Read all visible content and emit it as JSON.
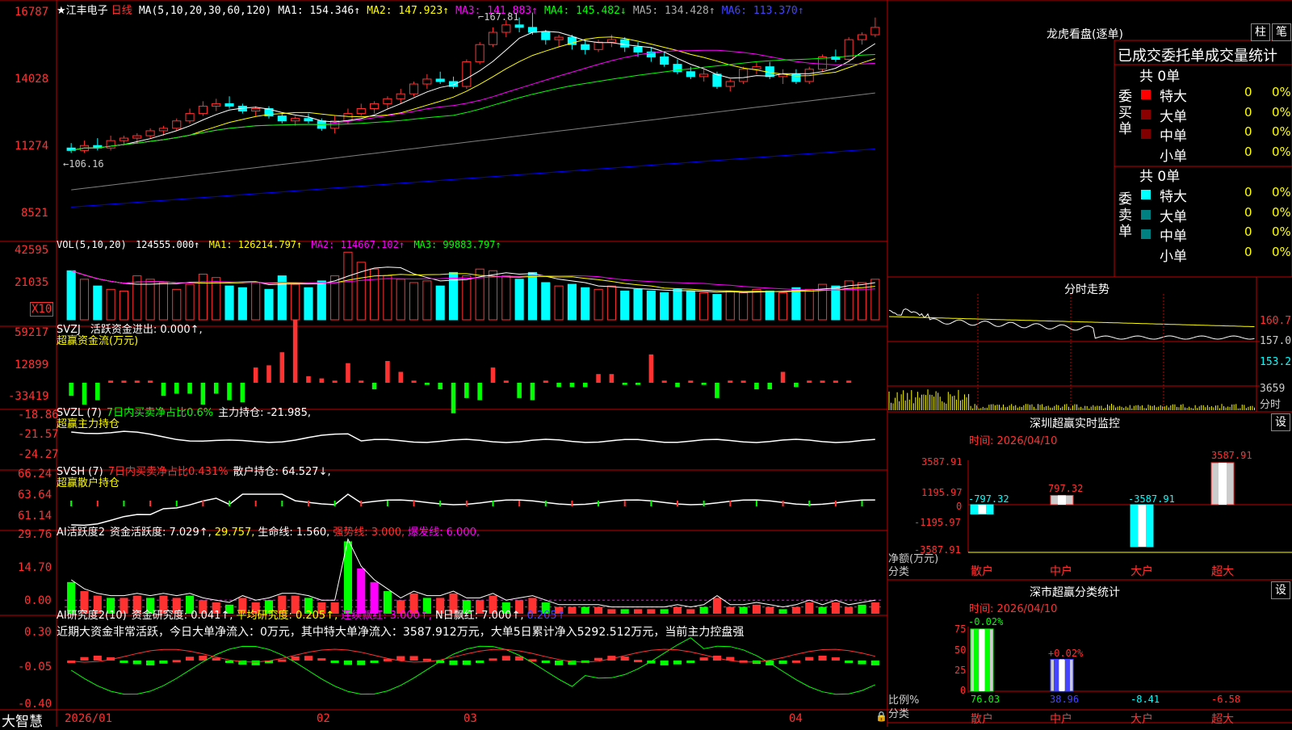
{
  "app": {
    "name": "大智慧",
    "stock": "江丰电子",
    "period": "日线"
  },
  "colors": {
    "up": "#ff3232",
    "down": "#00ffff",
    "grid": "#c00000",
    "ma1": "#ffffff",
    "ma2": "#ffff00",
    "ma3": "#ff00ff",
    "ma4": "#00ff00",
    "ma5": "#808080",
    "ma6": "#0000ff"
  },
  "kline": {
    "legend": {
      "label": "MA(5,10,20,30,60,120)",
      "ma1": "MA1: 154.346↑",
      "ma2": "MA2: 147.923↑",
      "ma3": "MA3: 141.883↑",
      "ma4": "MA4: 145.482↓",
      "ma5": "MA5: 134.428↑",
      "ma6": "MA6: 113.370↑"
    },
    "yticks": [
      "16787",
      "14028",
      "11274",
      "8521"
    ],
    "high_label": "167.81",
    "low_label": "←106.16"
  },
  "vol": {
    "label": "VOL(5,10,20)",
    "value": "124555.000↑",
    "ma1": "MA1: 126214.797↑",
    "ma2": "MA2: 114667.102↑",
    "ma3": "MA3: 99883.797↑",
    "yticks": [
      "42595",
      "21035"
    ],
    "unit": "X10"
  },
  "svzj": {
    "label": "SVZJ",
    "title": "活跃资金进出: 0.000↑,",
    "subtitle": "超赢资金流(万元)",
    "yticks": [
      "59217",
      "12899",
      "-33419"
    ]
  },
  "svzl": {
    "label": "SVZL (7)",
    "ratio": "7日内买卖净占比0.6%",
    "value": "主力持仓: -21.985,",
    "subtitle": "超赢主力持仓",
    "yticks": [
      "-18.86",
      "-21.57",
      "-24.27"
    ]
  },
  "svsh": {
    "label": "SVSH (7)",
    "ratio": "7日内买卖净占比0.431%",
    "value": "散户持仓: 64.527↓,",
    "subtitle": "超赢散户持仓",
    "yticks": [
      "66.24",
      "63.64",
      "61.14"
    ]
  },
  "ai1": {
    "label": "AI活跃度2",
    "val1": "资金活跃度: 7.029↑,",
    "val2": "29.757,",
    "val3": "生命线: 1.560,",
    "val4": "强势线: 3.000,",
    "val5": "爆发线: 6.000,",
    "yticks": [
      "29.76",
      "14.70",
      "0.00"
    ]
  },
  "ai2": {
    "label": "AI研究度2(10)",
    "v1": "资金研究度: 0.041↑,",
    "v2": "平均研究度: 0.205↑,",
    "v3": "连续飘红: 3.000↑,",
    "v4": "N日飘红: 7.000↑,",
    "v5": "0.205↑",
    "comment": "近期大资金非常活跃，今日大单净流入：0万元，其中特大单净流入：3587.912万元，大单5日累计净入5292.512万元，当前主力控盘强",
    "yticks": [
      "0.30",
      "-0.05",
      "-0.40"
    ]
  },
  "dates": {
    "d1": "2026/01",
    "d2": "02",
    "d3": "03",
    "d4": "04"
  },
  "longhu": {
    "title": "龙虎看盘(逐单)",
    "btn_bar": "柱",
    "btn_pen": "笔",
    "header": "已成交委托单成交量统计",
    "buy_label": "委买单",
    "sell_label": "委卖单",
    "buy_total": "共 0单",
    "sell_total": "共 0单",
    "buy_rows": [
      {
        "name": "特大",
        "count": "0",
        "pct": "0%"
      },
      {
        "name": "大单",
        "count": "0",
        "pct": "0%"
      },
      {
        "name": "中单",
        "count": "0",
        "pct": "0%"
      },
      {
        "name": "小单",
        "count": "0",
        "pct": "0%"
      }
    ],
    "sell_rows": [
      {
        "name": "特大",
        "count": "0",
        "pct": "0%"
      },
      {
        "name": "大单",
        "count": "0",
        "pct": "0%"
      },
      {
        "name": "中单",
        "count": "0",
        "pct": "0%"
      },
      {
        "name": "小单",
        "count": "0",
        "pct": "0%"
      }
    ]
  },
  "fenshi": {
    "title": "分时走势",
    "yticks": [
      "160.7",
      "157.0",
      "153.2"
    ],
    "vol": "3659",
    "unit": "分时"
  },
  "monitor": {
    "title": "深圳超赢实时监控",
    "btn": "设",
    "time": "时间: 2026/04/10",
    "yticks": [
      "3587.91",
      "1195.97",
      "0",
      "-1195.97",
      "-3587.91"
    ],
    "ylabel": "净额(万元)",
    "xlabel": "分类",
    "categories": [
      "散户",
      "中户",
      "大户",
      "超大"
    ],
    "bar_labels": [
      "-797.32",
      "797.32",
      "-3587.91",
      "3587.91"
    ]
  },
  "classify": {
    "title": "深市超赢分类统计",
    "btn": "设",
    "time": "时间: 2026/04/10",
    "yticks": [
      "75",
      "50",
      "25",
      "0"
    ],
    "ylabel": "比例%",
    "xlabel": "分类",
    "categories": [
      "散户",
      "中户",
      "大户",
      "超大"
    ],
    "top_labels": [
      "-0.02%",
      "+0.02%"
    ],
    "bottom_labels": [
      "76.03",
      "38.96",
      "-8.41",
      "-6.58"
    ]
  },
  "chart_data": [
    {
      "type": "candlestick",
      "title": "江丰电子 日线",
      "ylim": [
        85.21,
        167.87
      ],
      "ohlc": [
        [
          113,
          115,
          111,
          112
        ],
        [
          112,
          116,
          111,
          114
        ],
        [
          114,
          117,
          112,
          113
        ],
        [
          113,
          118,
          112,
          116
        ],
        [
          116,
          118,
          114,
          117
        ],
        [
          117,
          119,
          115,
          118
        ],
        [
          118,
          121,
          117,
          120
        ],
        [
          120,
          122,
          118,
          121
        ],
        [
          121,
          125,
          120,
          124
        ],
        [
          124,
          129,
          123,
          127
        ],
        [
          127,
          132,
          126,
          130
        ],
        [
          130,
          133,
          128,
          131
        ],
        [
          131,
          134,
          129,
          130
        ],
        [
          130,
          131,
          127,
          128
        ],
        [
          128,
          130,
          126,
          129
        ],
        [
          129,
          130,
          125,
          126
        ],
        [
          126,
          127,
          123,
          124
        ],
        [
          124,
          126,
          122,
          125
        ],
        [
          125,
          127,
          123,
          124
        ],
        [
          124,
          125,
          120,
          121
        ],
        [
          121,
          126,
          119,
          124
        ],
        [
          124,
          129,
          123,
          127
        ],
        [
          127,
          131,
          126,
          129
        ],
        [
          129,
          132,
          127,
          131
        ],
        [
          131,
          134,
          129,
          133
        ],
        [
          133,
          137,
          131,
          135
        ],
        [
          135,
          140,
          134,
          139
        ],
        [
          139,
          143,
          137,
          141
        ],
        [
          141,
          144,
          139,
          140
        ],
        [
          140,
          142,
          137,
          138
        ],
        [
          138,
          149,
          137,
          148
        ],
        [
          148,
          156,
          147,
          155
        ],
        [
          155,
          162,
          154,
          160
        ],
        [
          160,
          165,
          158,
          163
        ],
        [
          163,
          166,
          160,
          162
        ],
        [
          162,
          168,
          159,
          160
        ],
        [
          160,
          161,
          155,
          157
        ],
        [
          157,
          159,
          154,
          158
        ],
        [
          158,
          159,
          153,
          155
        ],
        [
          155,
          157,
          151,
          153
        ],
        [
          153,
          157,
          152,
          156
        ],
        [
          156,
          159,
          154,
          157
        ],
        [
          157,
          158,
          152,
          154
        ],
        [
          154,
          156,
          150,
          152
        ],
        [
          152,
          154,
          148,
          150
        ],
        [
          150,
          152,
          146,
          147
        ],
        [
          147,
          149,
          143,
          144
        ],
        [
          144,
          146,
          141,
          142
        ],
        [
          142,
          145,
          140,
          143
        ],
        [
          143,
          144,
          137,
          138
        ],
        [
          138,
          141,
          136,
          140
        ],
        [
          140,
          146,
          139,
          145
        ],
        [
          145,
          148,
          143,
          146
        ],
        [
          146,
          148,
          141,
          142
        ],
        [
          142,
          145,
          139,
          143
        ],
        [
          143,
          145,
          139,
          140
        ],
        [
          140,
          146,
          139,
          145
        ],
        [
          145,
          151,
          144,
          150
        ],
        [
          150,
          153,
          148,
          149
        ],
        [
          149,
          158,
          148,
          157
        ],
        [
          157,
          160,
          155,
          159
        ],
        [
          159,
          166,
          158,
          162
        ]
      ],
      "start_date": "2026/01"
    },
    {
      "type": "bar",
      "title": "VOL",
      "values": [
        290,
        240,
        200,
        180,
        170,
        260,
        240,
        220,
        180,
        210,
        270,
        250,
        200,
        190,
        220,
        180,
        260,
        210,
        190,
        230,
        260,
        400,
        340,
        300,
        260,
        240,
        220,
        230,
        200,
        280,
        260,
        300,
        290,
        260,
        240,
        280,
        220,
        200,
        210,
        190,
        180,
        200,
        170,
        180,
        170,
        160,
        180,
        170,
        160,
        150,
        170,
        160,
        180,
        170,
        160,
        190,
        180,
        210,
        200,
        230,
        220,
        240
      ]
    },
    {
      "type": "bar",
      "title": "SVZJ",
      "values": [
        -6,
        -10,
        -8,
        1,
        1,
        1,
        1,
        -6,
        -5,
        -5,
        -10,
        -5,
        -8,
        -9,
        7,
        8,
        14,
        29,
        3,
        2,
        1,
        9,
        1,
        -3,
        10,
        5,
        1,
        -1,
        -3,
        -14,
        -7,
        -8,
        7,
        1,
        -7,
        -8,
        1,
        -2,
        -2,
        -2,
        4,
        4,
        -1,
        -1,
        13,
        1,
        -2,
        1,
        -1,
        -7,
        1,
        1,
        -3,
        -3,
        5,
        -2,
        1,
        1,
        1,
        1
      ]
    }
  ]
}
